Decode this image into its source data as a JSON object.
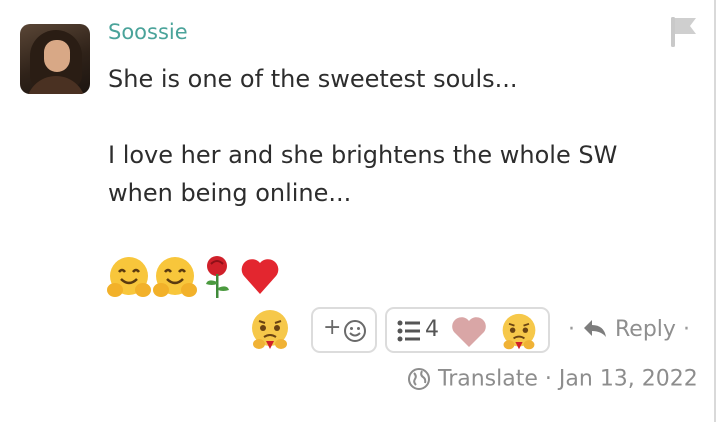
{
  "comment": {
    "author": "Soossie",
    "paragraphs": [
      "She is one of the sweetest souls...",
      "I love her and she brightens the whole SW when being online..."
    ],
    "emojis": [
      "hugging-face",
      "hugging-face",
      "rose",
      "red-heart"
    ]
  },
  "reactions": {
    "leading_emoji": "face-holding-back-tears",
    "add_label": "+",
    "list_count": "4",
    "list_emojis": [
      "light-heart",
      "face-holding-back-tears"
    ]
  },
  "actions": {
    "reply_label": "Reply",
    "separator": "·"
  },
  "meta": {
    "translate_label": "Translate",
    "date": "Jan 13, 2022"
  },
  "colors": {
    "author": "#4aa39a",
    "text": "#2d2d2d",
    "muted": "#8d8d8d",
    "border": "#dcdcdc"
  }
}
